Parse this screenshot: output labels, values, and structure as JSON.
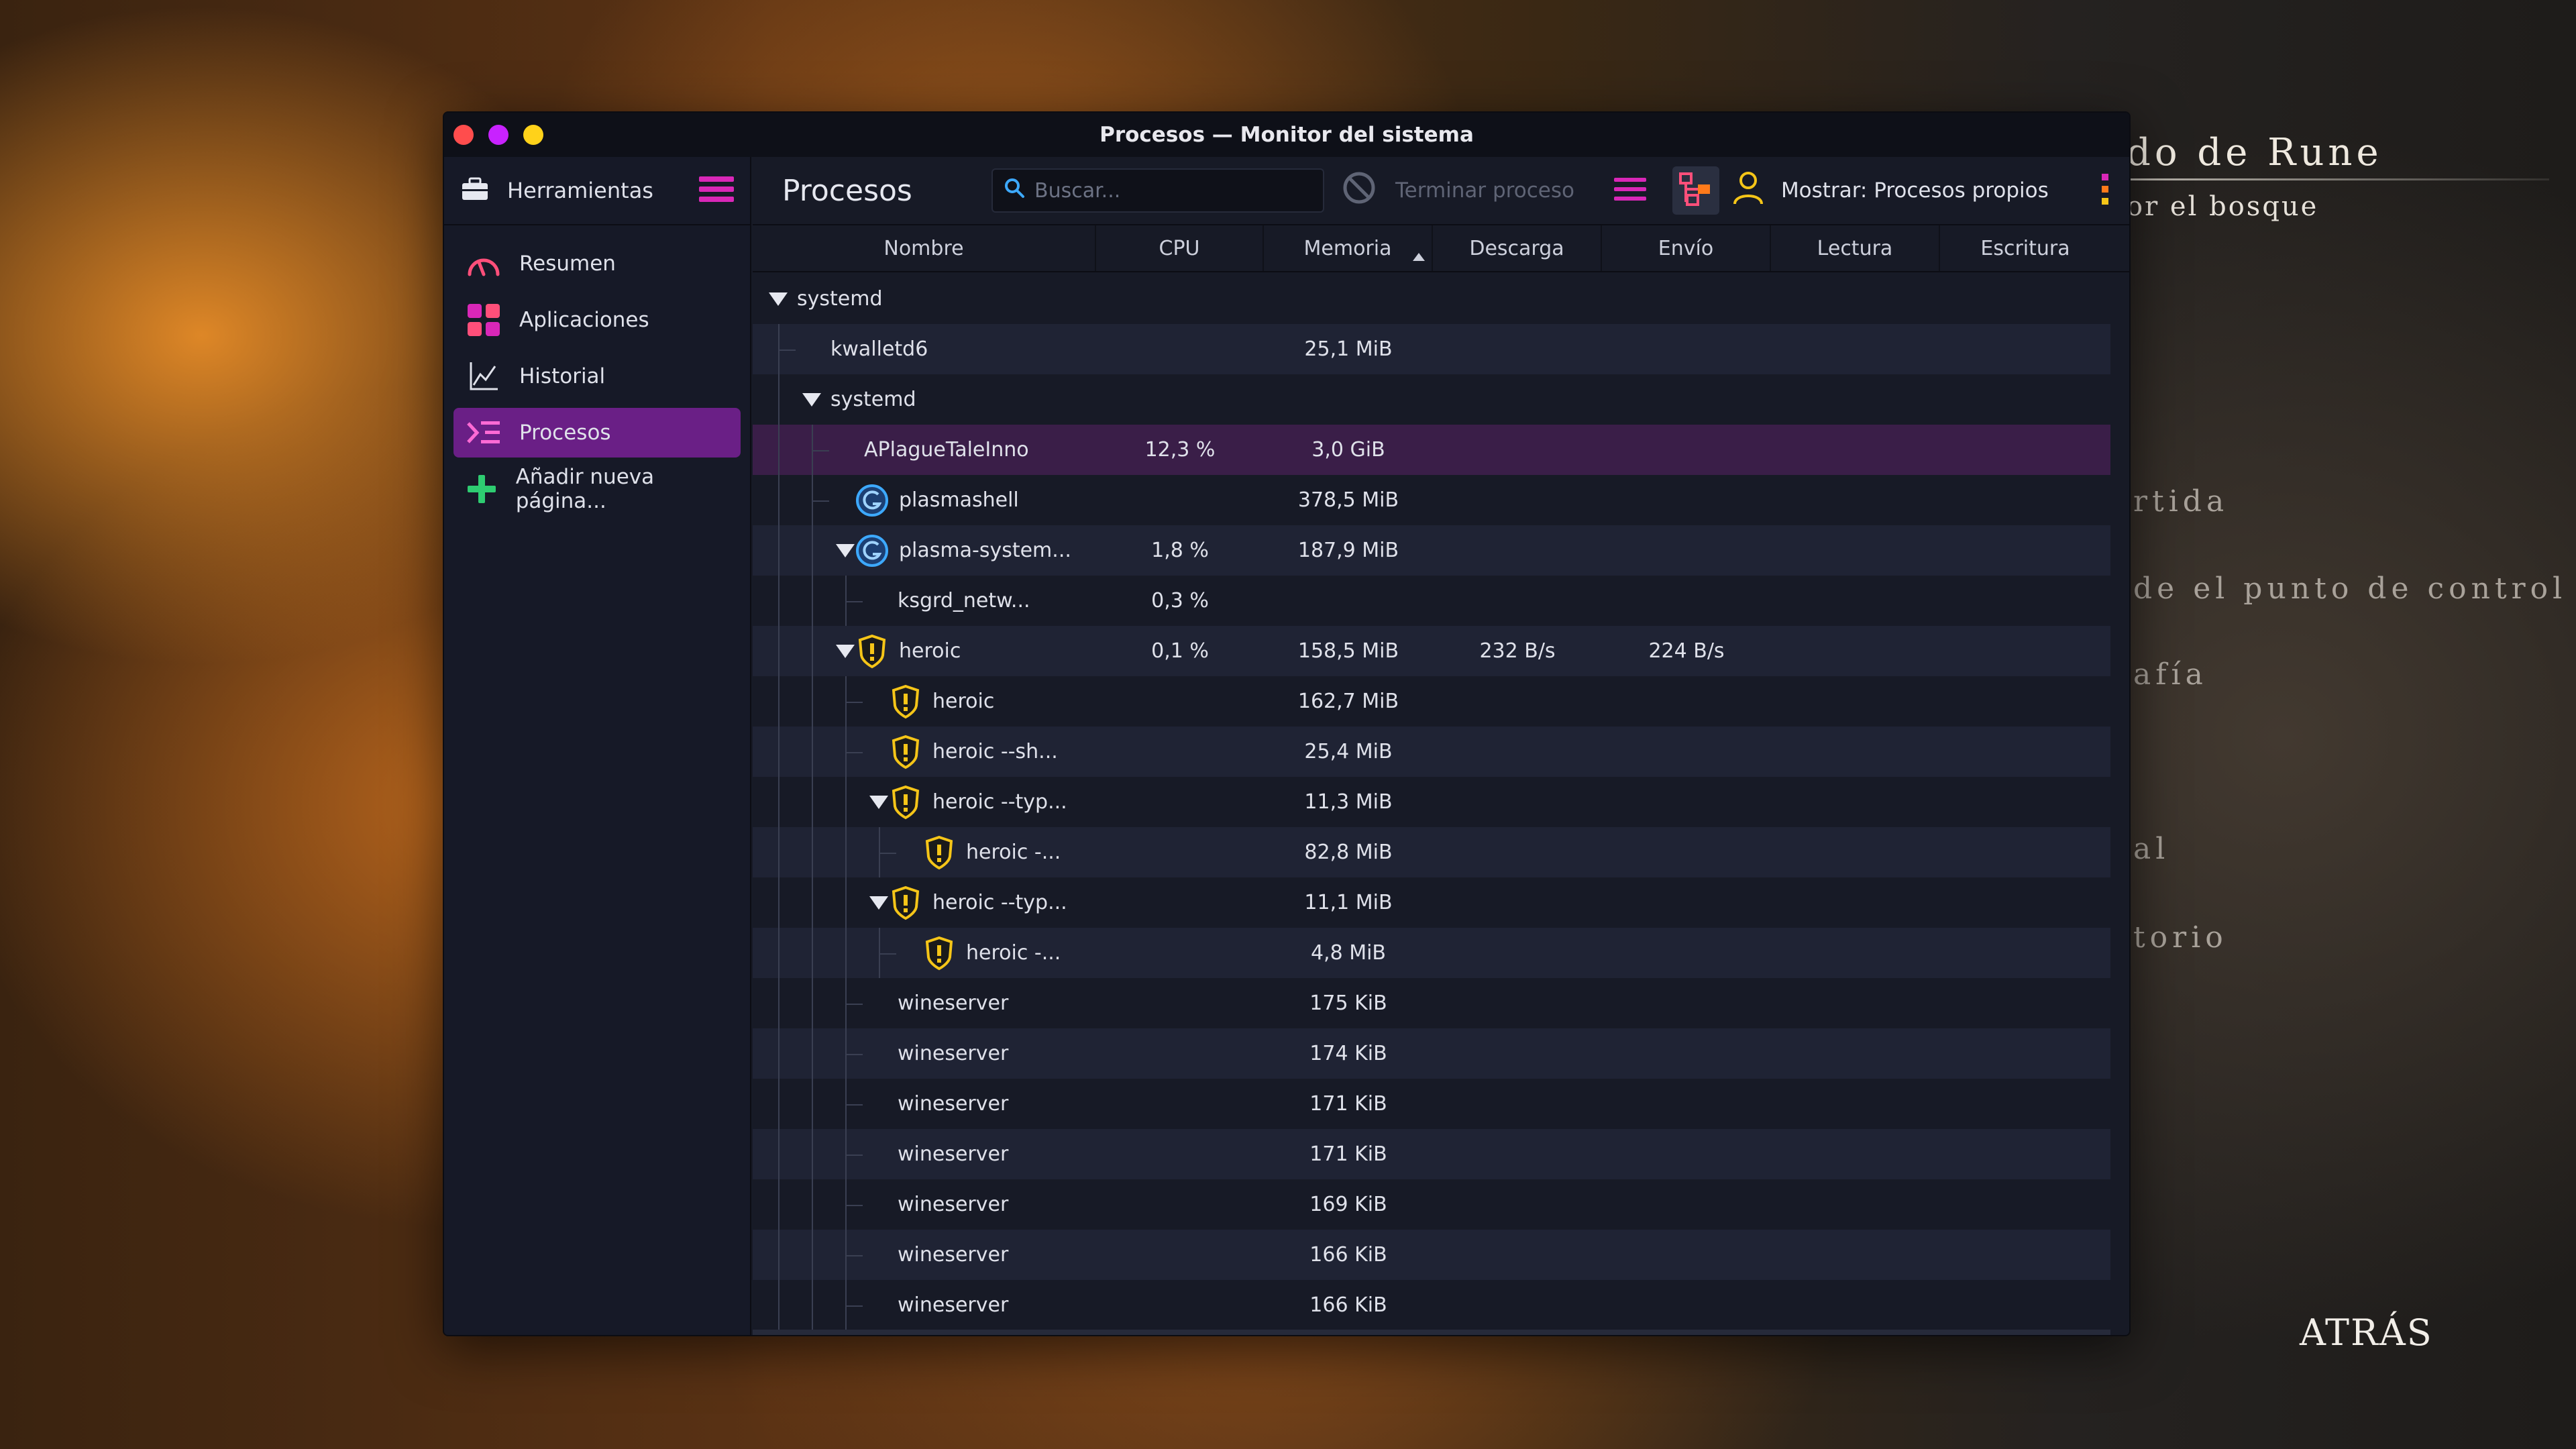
{
  "background_game": {
    "title": "do de Rune",
    "subtitle": "or el bosque",
    "menu_items": [
      "rtida",
      "de el punto de control",
      "afía",
      "al",
      "torio"
    ],
    "back": "ATRÁS"
  },
  "window": {
    "title": "Procesos — Monitor del sistema",
    "controls": {
      "close_color": "#ff4d4d",
      "minimize_color": "#c822ff",
      "maximize_color": "#ffd21a"
    }
  },
  "sidebar": {
    "tools_label": "Herramientas",
    "items": [
      {
        "label": "Resumen",
        "icon": "speedometer-icon",
        "active": false
      },
      {
        "label": "Aplicaciones",
        "icon": "apps-grid-icon",
        "active": false
      },
      {
        "label": "Historial",
        "icon": "line-chart-icon",
        "active": false
      },
      {
        "label": "Procesos",
        "icon": "process-list-icon",
        "active": true
      },
      {
        "label": "Añadir nueva página...",
        "icon": "plus-icon",
        "active": false
      }
    ]
  },
  "toolbar": {
    "page_title": "Procesos",
    "search_placeholder": "Buscar...",
    "terminate_label": "Terminar proceso",
    "show_label": "Mostrar: Procesos propios"
  },
  "columns": [
    "Nombre",
    "CPU",
    "Memoria",
    "Descarga",
    "Envío",
    "Lectura",
    "Escritura"
  ],
  "sort": {
    "column": "Memoria",
    "direction": "ascending"
  },
  "processes": [
    {
      "name": "systemd",
      "cpu": "",
      "mem": "",
      "down": "",
      "up": "",
      "depth": 0,
      "expanded": true,
      "icon": "none"
    },
    {
      "name": "kwalletd6",
      "cpu": "",
      "mem": "25,1 MiB",
      "down": "",
      "up": "",
      "depth": 1,
      "icon": "none"
    },
    {
      "name": "systemd",
      "cpu": "",
      "mem": "",
      "down": "",
      "up": "",
      "depth": 1,
      "expanded": true,
      "icon": "none"
    },
    {
      "name": "APlagueTaleInno",
      "cpu": "12,3 %",
      "mem": "3,0 GiB",
      "down": "",
      "up": "",
      "depth": 2,
      "icon": "none",
      "selected": true
    },
    {
      "name": "plasmashell",
      "cpu": "",
      "mem": "378,5 MiB",
      "down": "",
      "up": "",
      "depth": 2,
      "icon": "plasma"
    },
    {
      "name": "plasma-system...",
      "cpu": "1,8 %",
      "mem": "187,9 MiB",
      "down": "",
      "up": "",
      "depth": 2,
      "expanded": true,
      "icon": "plasma"
    },
    {
      "name": "ksgrd_netw...",
      "cpu": "0,3 %",
      "mem": "",
      "down": "",
      "up": "",
      "depth": 3,
      "icon": "none"
    },
    {
      "name": "heroic",
      "cpu": "0,1 %",
      "mem": "158,5 MiB",
      "down": "232 B/s",
      "up": "224 B/s",
      "depth": 2,
      "expanded": true,
      "icon": "heroic"
    },
    {
      "name": "heroic",
      "cpu": "",
      "mem": "162,7 MiB",
      "down": "",
      "up": "",
      "depth": 3,
      "icon": "heroic"
    },
    {
      "name": "heroic --sh...",
      "cpu": "",
      "mem": "25,4 MiB",
      "down": "",
      "up": "",
      "depth": 3,
      "icon": "heroic"
    },
    {
      "name": "heroic --typ...",
      "cpu": "",
      "mem": "11,3 MiB",
      "down": "",
      "up": "",
      "depth": 3,
      "expanded": true,
      "icon": "heroic"
    },
    {
      "name": "heroic -...",
      "cpu": "",
      "mem": "82,8 MiB",
      "down": "",
      "up": "",
      "depth": 4,
      "icon": "heroic"
    },
    {
      "name": "heroic --typ...",
      "cpu": "",
      "mem": "11,1 MiB",
      "down": "",
      "up": "",
      "depth": 3,
      "expanded": true,
      "icon": "heroic"
    },
    {
      "name": "heroic -...",
      "cpu": "",
      "mem": "4,8 MiB",
      "down": "",
      "up": "",
      "depth": 4,
      "icon": "heroic"
    },
    {
      "name": "wineserver",
      "cpu": "",
      "mem": "175 KiB",
      "down": "",
      "up": "",
      "depth": 3,
      "icon": "none"
    },
    {
      "name": "wineserver",
      "cpu": "",
      "mem": "174 KiB",
      "down": "",
      "up": "",
      "depth": 3,
      "icon": "none"
    },
    {
      "name": "wineserver",
      "cpu": "",
      "mem": "171 KiB",
      "down": "",
      "up": "",
      "depth": 3,
      "icon": "none"
    },
    {
      "name": "wineserver",
      "cpu": "",
      "mem": "171 KiB",
      "down": "",
      "up": "",
      "depth": 3,
      "icon": "none"
    },
    {
      "name": "wineserver",
      "cpu": "",
      "mem": "169 KiB",
      "down": "",
      "up": "",
      "depth": 3,
      "icon": "none"
    },
    {
      "name": "wineserver",
      "cpu": "",
      "mem": "166 KiB",
      "down": "",
      "up": "",
      "depth": 3,
      "icon": "none"
    },
    {
      "name": "wineserver",
      "cpu": "",
      "mem": "166 KiB",
      "down": "",
      "up": "",
      "depth": 3,
      "icon": "none"
    }
  ],
  "colors": {
    "accent": "#6a1f86",
    "magenta": "#d927b8",
    "heroic_yellow": "#f5c518",
    "plasma_blue": "#3da9ff"
  }
}
